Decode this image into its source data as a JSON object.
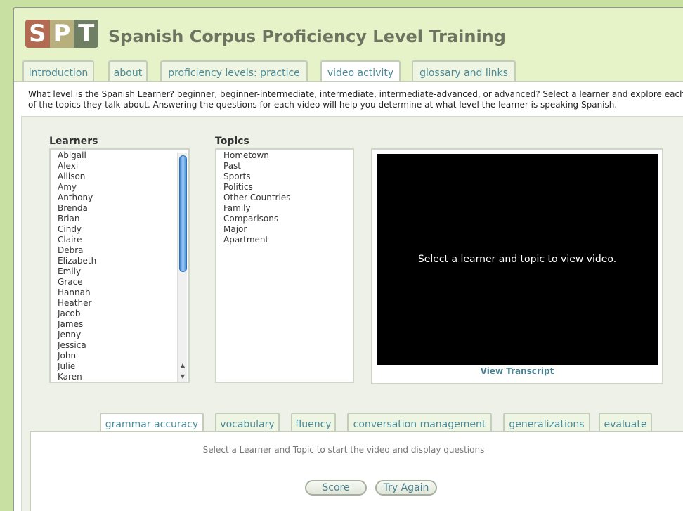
{
  "header": {
    "logo_letters": [
      "S",
      "P",
      "T"
    ],
    "title": "Spanish Corpus Proficiency Level Training"
  },
  "nav_tabs": [
    {
      "label": "introduction",
      "active": false
    },
    {
      "label": "about",
      "active": false
    },
    {
      "label": "proficiency levels: practice",
      "active": false
    },
    {
      "label": "video activity",
      "active": true
    },
    {
      "label": "glossary and links",
      "active": false
    }
  ],
  "instructions": "What level is the Spanish Learner? beginner, beginner-intermediate, intermediate, intermediate-advanced, or advanced? Select a learner and explore each of the topics they talk about. Answering the questions for each video will help you determine at what level the learner is speaking Spanish.",
  "learners": {
    "heading": "Learners",
    "items": [
      "Abigail",
      "Alexi",
      "Allison",
      "Amy",
      "Anthony",
      "Brenda",
      "Brian",
      "Cindy",
      "Claire",
      "Debra",
      "Elizabeth",
      "Emily",
      "Grace",
      "Hannah",
      "Heather",
      "Jacob",
      "James",
      "Jenny",
      "Jessica",
      "John",
      "Julie",
      "Karen"
    ]
  },
  "topics": {
    "heading": "Topics",
    "items": [
      "Hometown",
      "Past",
      "Sports",
      "Politics",
      "Other Countries",
      "Family",
      "Comparisons",
      "Major",
      "Apartment"
    ]
  },
  "video": {
    "placeholder": "Select a learner and topic to view video.",
    "transcript_link": "View Transcript"
  },
  "question_tabs": [
    {
      "label": "grammar accuracy",
      "active": true
    },
    {
      "label": "vocabulary",
      "active": false
    },
    {
      "label": "fluency",
      "active": false
    },
    {
      "label": "conversation management",
      "active": false
    },
    {
      "label": "generalizations",
      "active": false
    },
    {
      "label": "evaluate",
      "active": false
    }
  ],
  "question_panel": {
    "message": "Select a Learner and Topic to start the video and display questions",
    "score_label": "Score",
    "try_again_label": "Try Again"
  },
  "colors": {
    "background": "#c9e0a3",
    "frame": "#e6f3c9",
    "tab_text": "#4b8a97",
    "title_text": "#6d745f"
  }
}
